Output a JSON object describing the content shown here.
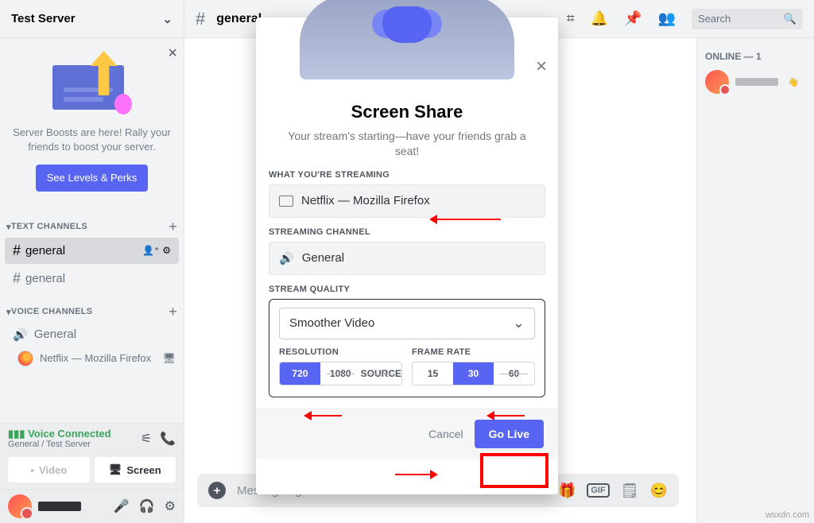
{
  "server": {
    "name": "Test Server"
  },
  "boost": {
    "text": "Server Boosts are here! Rally your friends to boost your server.",
    "cta": "See Levels & Perks"
  },
  "sections": {
    "text": "TEXT CHANNELS",
    "voice": "VOICE CHANNELS"
  },
  "channels": {
    "general1": "general",
    "general2": "general",
    "voice_general": "General",
    "voice_member": "Netflix — Mozilla Firefox"
  },
  "voice_panel": {
    "status": "Voice Connected",
    "path": "General / Test Server",
    "video_btn": "Video",
    "screen_btn": "Screen"
  },
  "topbar": {
    "channel": "general",
    "search_ph": "Search"
  },
  "compose": {
    "placeholder": "Message #general"
  },
  "members": {
    "heading": "ONLINE — 1"
  },
  "modal": {
    "title": "Screen Share",
    "subtitle": "Your stream's starting—have your friends grab a seat!",
    "label_streaming": "WHAT YOU'RE STREAMING",
    "streaming_value": "Netflix — Mozilla Firefox",
    "label_channel": "STREAMING CHANNEL",
    "channel_value": "General",
    "label_quality": "STREAM QUALITY",
    "quality_preset": "Smoother Video",
    "label_resolution": "RESOLUTION",
    "res_options": {
      "active": "720",
      "locked1": "1080",
      "locked2": "SOURCE"
    },
    "label_framerate": "FRAME RATE",
    "fps_options": {
      "opt1": "15",
      "active": "30",
      "locked": "60"
    },
    "cancel": "Cancel",
    "go_live": "Go Live"
  },
  "watermark": "wsxdn.com"
}
